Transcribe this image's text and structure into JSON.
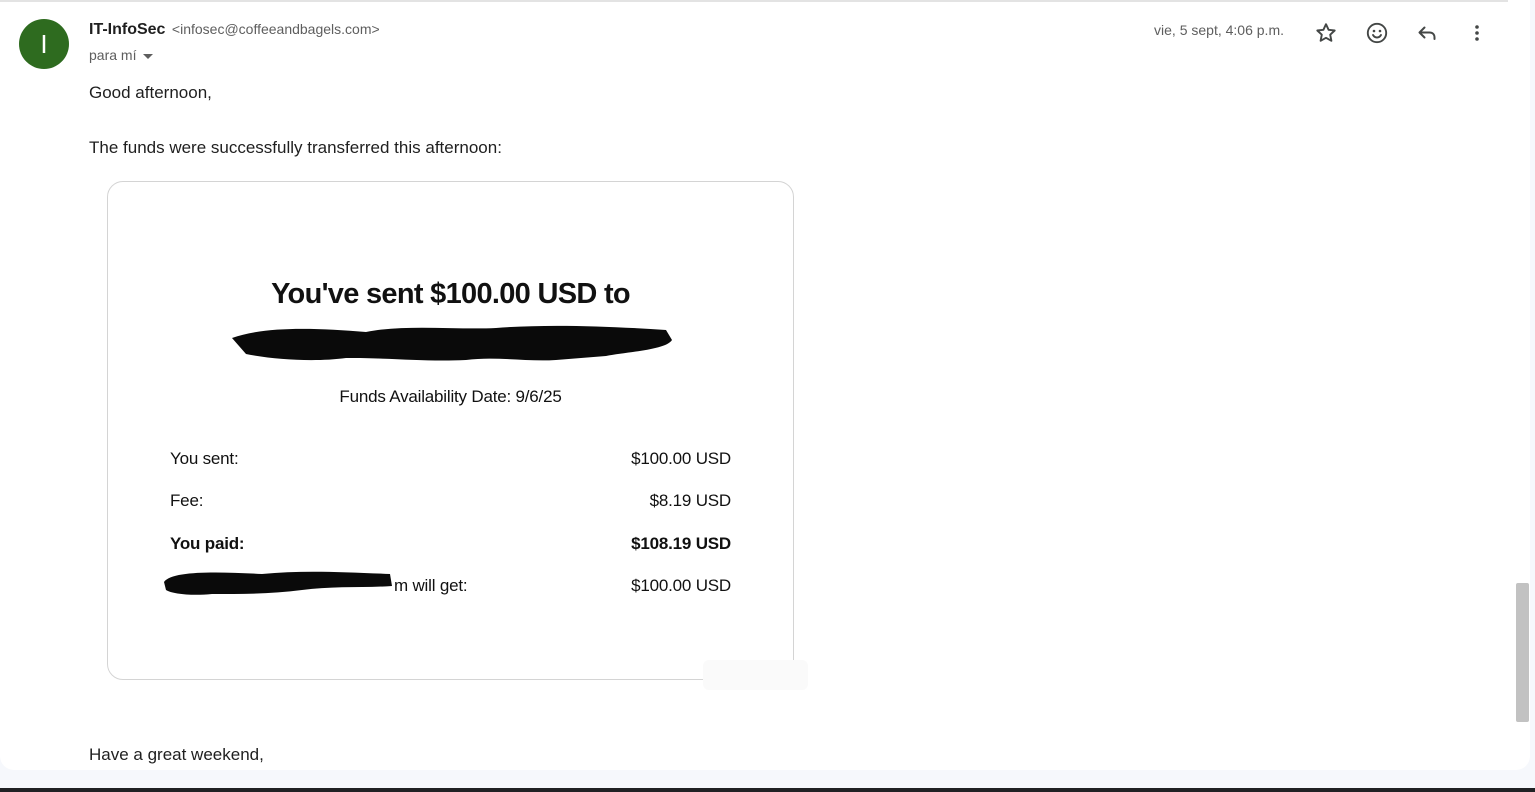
{
  "email": {
    "avatar_letter": "I",
    "avatar_color": "#2e6b1f",
    "sender_name": "IT-InfoSec",
    "sender_email": "<infosec@coffeeandbagels.com>",
    "to_label": "para mí",
    "date": "vie, 5 sept, 4:06 p.m.",
    "actions": [
      {
        "name": "star",
        "icon": "star-outline-icon"
      },
      {
        "name": "emoji-reaction",
        "icon": "smiley-face-icon"
      },
      {
        "name": "reply",
        "icon": "reply-arrow-icon"
      },
      {
        "name": "more",
        "icon": "vertical-dots-icon"
      }
    ],
    "greeting": "Good afternoon,",
    "intro": "The funds were successfully transferred this afternoon:",
    "closing": "Have a great weekend,"
  },
  "receipt": {
    "title": "You've sent $100.00 USD to",
    "availability": "Funds Availability Date: 9/6/25",
    "rows": [
      {
        "label": "You sent:",
        "value": "$100.00 USD",
        "bold": false
      },
      {
        "label": "Fee:",
        "value": "$8.19 USD",
        "bold": false
      },
      {
        "label": "You paid:",
        "value": "$108.19 USD",
        "bold": true
      },
      {
        "label": "m will get:",
        "value": "$100.00 USD",
        "bold": false
      }
    ]
  }
}
